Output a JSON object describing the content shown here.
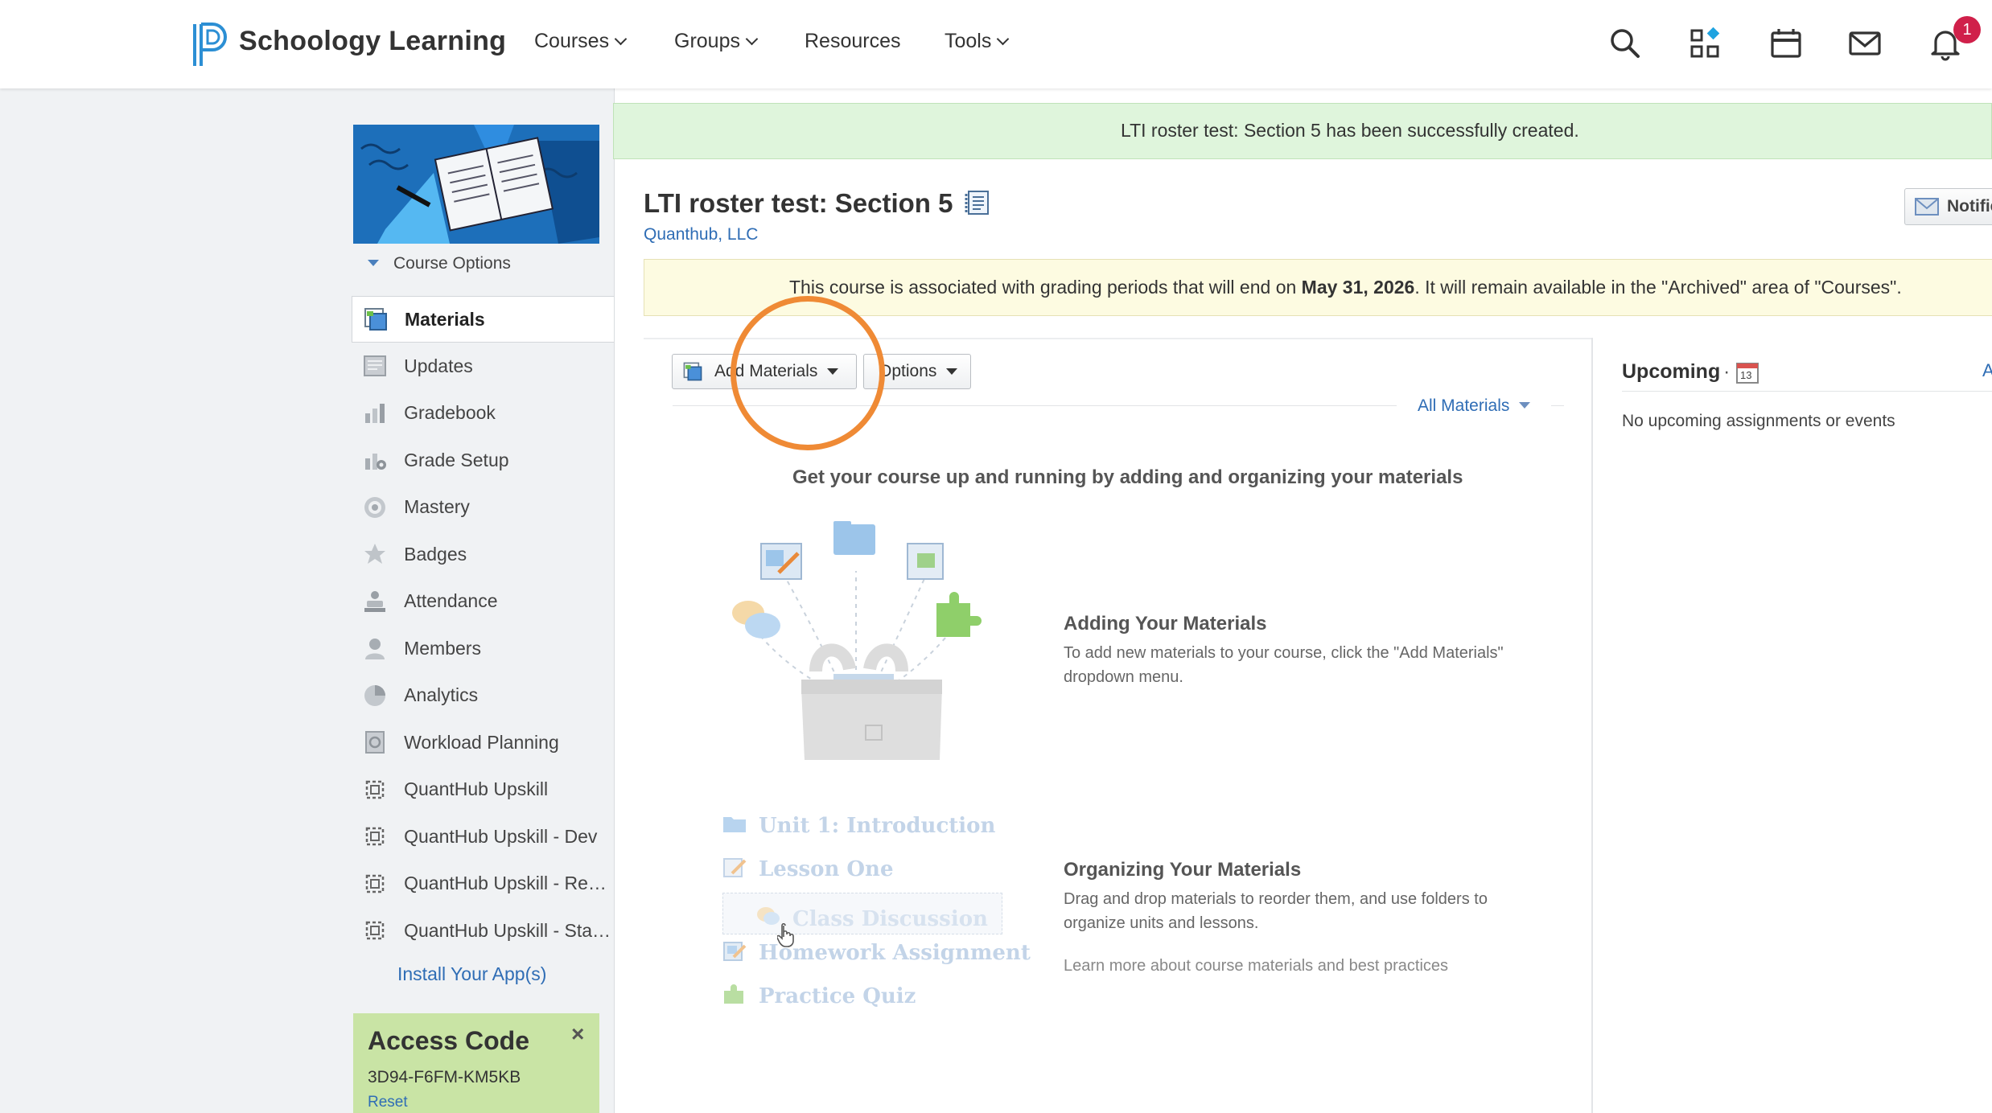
{
  "brand": {
    "name": "Schoology Learning"
  },
  "topnav": {
    "items": [
      {
        "label": "Courses",
        "has_dropdown": true
      },
      {
        "label": "Groups",
        "has_dropdown": true
      },
      {
        "label": "Resources",
        "has_dropdown": false
      },
      {
        "label": "Tools",
        "has_dropdown": true
      }
    ],
    "icons": [
      "search-icon",
      "apps-grid-icon",
      "calendar-icon",
      "mail-icon",
      "bell-icon"
    ],
    "notification_count": "1"
  },
  "sidebar": {
    "course_options_label": "Course Options",
    "items": [
      {
        "label": "Materials",
        "icon": "materials-icon",
        "active": true
      },
      {
        "label": "Updates",
        "icon": "updates-icon"
      },
      {
        "label": "Gradebook",
        "icon": "gradebook-icon"
      },
      {
        "label": "Grade Setup",
        "icon": "grade-setup-icon"
      },
      {
        "label": "Mastery",
        "icon": "mastery-icon"
      },
      {
        "label": "Badges",
        "icon": "badges-icon"
      },
      {
        "label": "Attendance",
        "icon": "attendance-icon"
      },
      {
        "label": "Members",
        "icon": "members-icon"
      },
      {
        "label": "Analytics",
        "icon": "analytics-icon"
      },
      {
        "label": "Workload Planning",
        "icon": "workload-icon"
      },
      {
        "label": "QuantHub Upskill",
        "icon": "app-puzzle-icon"
      },
      {
        "label": "QuantHub Upskill - Dev",
        "icon": "app-puzzle-icon"
      },
      {
        "label": "QuantHub Upskill - Revie...",
        "icon": "app-puzzle-icon"
      },
      {
        "label": "QuantHub Upskill - Stagi...",
        "icon": "app-puzzle-icon"
      }
    ],
    "install_label": "Install Your App(s)",
    "access_code": {
      "title": "Access Code",
      "code": "3D94-F6FM-KM5KB",
      "reset": "Reset"
    }
  },
  "main": {
    "success_message": "LTI roster test: Section 5 has been successfully created.",
    "title": "LTI roster test: Section 5",
    "org": "Quanthub, LLC",
    "notif_button": "Notifications",
    "grading": {
      "before": "This course is associated with grading periods that will end on ",
      "date": "May 31, 2026",
      "after": ". It will remain available in the \"Archived\" area of \"Courses\"."
    },
    "toolbar": {
      "add_materials": "Add Materials",
      "options": "Options"
    },
    "filter": "All Materials",
    "headline": "Get your course up and running by adding and organizing your materials",
    "adding": {
      "title": "Adding Your Materials",
      "body": "To add new materials to your course, click the \"Add Materials\" dropdown menu."
    },
    "organizing": {
      "title": "Organizing Your Materials",
      "body": "Drag and drop materials to reorder them, and use folders to organize units and lessons.",
      "learn_more": "Learn more about course materials and best practices"
    },
    "demo_items": [
      "Unit 1: Introduction",
      "Lesson One",
      "Class Discussion",
      "Homework Assignment",
      "Practice Quiz"
    ]
  },
  "upcoming": {
    "title": "Upcoming",
    "calendar_day": "13",
    "empty": "No upcoming assignments or events",
    "cut_link": "A"
  },
  "colors": {
    "accent": "#2f6db5",
    "success_bg": "#dff5dc",
    "warning_bg": "#fdfbe1",
    "highlight": "#ef8a35",
    "badge": "#d0204a"
  }
}
